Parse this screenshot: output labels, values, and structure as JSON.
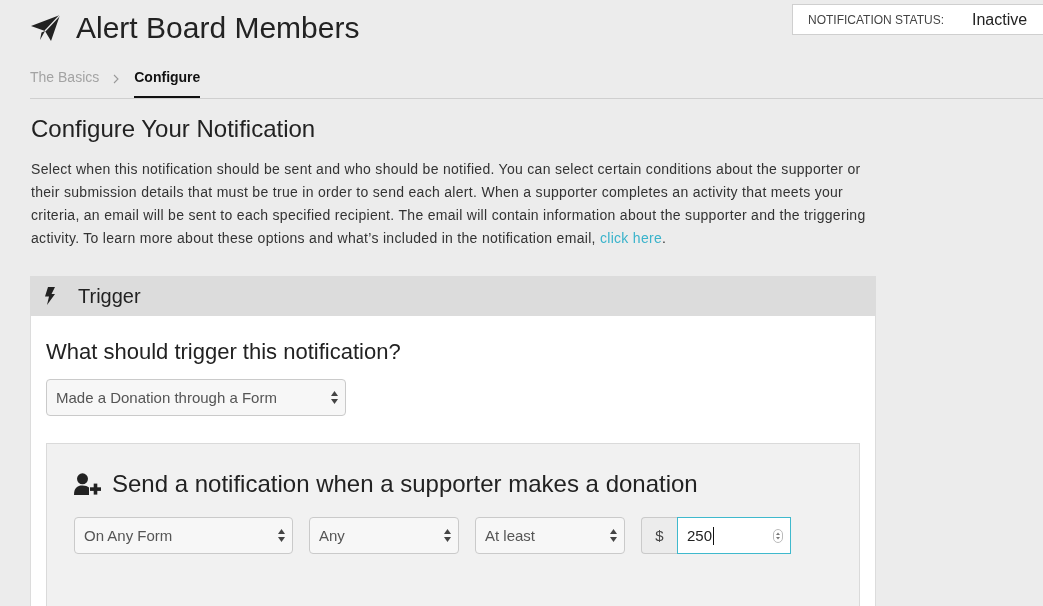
{
  "header": {
    "title": "Alert Board Members",
    "status_label": "NOTIFICATION STATUS:",
    "status_value": "Inactive"
  },
  "breadcrumbs": [
    {
      "label": "The Basics",
      "selected": false
    },
    {
      "label": "Configure",
      "selected": true
    }
  ],
  "intro": {
    "title": "Configure Your Notification",
    "description": "Select when this notification should be sent and who should be notified. You can select certain conditions about the supporter or their submission details that must be true in order to send each alert. When a supporter completes an activity that meets your criteria, an email will be sent to each specified recipient. The email will contain information about the supporter and the triggering activity. To learn more about these options and what’s included in the notification email, ",
    "link": "click here",
    "description_end": "."
  },
  "trigger": {
    "title": "Trigger",
    "question": "What should trigger this notification?",
    "trigger_select": "Made a Donation through a Form",
    "condition": {
      "title": "Send a notification when a supporter makes a donation",
      "fields": [
        {
          "kind": "select",
          "value": "On Any Form"
        },
        {
          "kind": "select",
          "value": "Any"
        },
        {
          "kind": "select",
          "value": "At least"
        },
        {
          "kind": "amount",
          "prefix": "$",
          "value": "250",
          "focused": true
        }
      ]
    }
  }
}
